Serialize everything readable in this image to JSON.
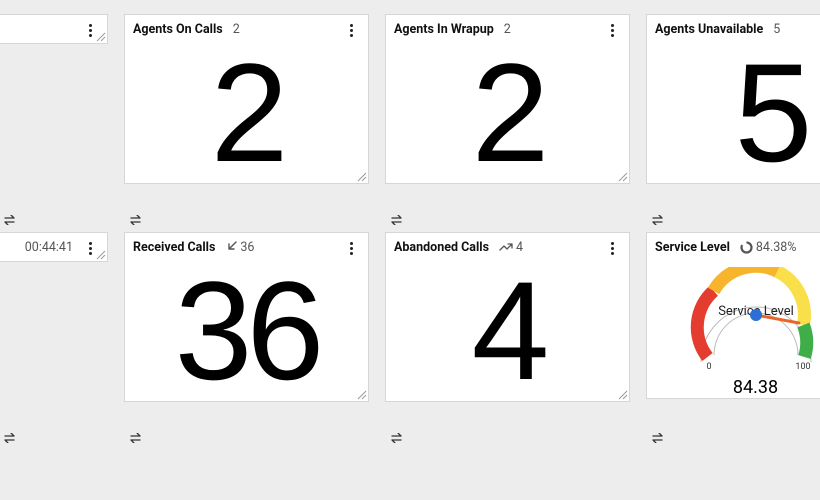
{
  "cards": [
    {
      "id": "partial-top",
      "title": "",
      "sub": "",
      "value": ""
    },
    {
      "id": "agents-on-calls",
      "title": "Agents On Calls",
      "sub": "2",
      "value": "2"
    },
    {
      "id": "agents-in-wrapup",
      "title": "Agents In Wrapup",
      "sub": "2",
      "value": "2"
    },
    {
      "id": "agents-unavailable",
      "title": "Agents Unavailable",
      "sub": "5",
      "value": "5"
    },
    {
      "id": "partial-bottom",
      "title": "",
      "sub": "00:44:41",
      "value": ""
    },
    {
      "id": "received-calls",
      "title": "Received Calls",
      "sub": "36",
      "value": "36",
      "subIcon": "incoming"
    },
    {
      "id": "abandoned-calls",
      "title": "Abandoned Calls",
      "sub": "4",
      "value": "4",
      "subIcon": "missed"
    },
    {
      "id": "service-level",
      "title": "Service Level",
      "sub": "84.38%",
      "gauge": {
        "label": "Service Level",
        "value": "84.38",
        "min": "0",
        "max": "100",
        "pct": 84.38
      }
    }
  ],
  "chart_data": {
    "type": "gauge",
    "title": "Service Level",
    "value": 84.38,
    "min": 0,
    "max": 100,
    "unit": "%",
    "color_bands": [
      {
        "from": 0,
        "to": 25,
        "color": "#e43c2f"
      },
      {
        "from": 25,
        "to": 50,
        "color": "#f6b52c"
      },
      {
        "from": 50,
        "to": 75,
        "color": "#f9e04a"
      },
      {
        "from": 75,
        "to": 100,
        "color": "#3fae49"
      }
    ]
  }
}
